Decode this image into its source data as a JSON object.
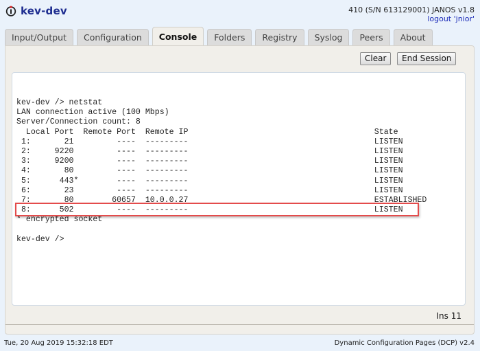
{
  "header": {
    "title": "kev-dev",
    "icon": "info-power-icon",
    "device_info": "410 (S/N 613129001) JANOS v1.8",
    "logout_label": "logout 'jnior'"
  },
  "tabs": [
    {
      "label": "Input/Output",
      "active": false
    },
    {
      "label": "Configuration",
      "active": false
    },
    {
      "label": "Console",
      "active": true
    },
    {
      "label": "Folders",
      "active": false
    },
    {
      "label": "Registry",
      "active": false
    },
    {
      "label": "Syslog",
      "active": false
    },
    {
      "label": "Peers",
      "active": false
    },
    {
      "label": "About",
      "active": false
    }
  ],
  "toolbar": {
    "clear_label": "Clear",
    "end_session_label": "End Session"
  },
  "console": {
    "lines": [
      "kev-dev /> netstat",
      "LAN connection active (100 Mbps)",
      "Server/Connection count: 8",
      "  Local Port  Remote Port  Remote IP                                       State",
      " 1:       21         ----  ---------                                       LISTEN",
      " 2:     9220         ----  ---------                                       LISTEN",
      " 3:     9200         ----  ---------                                       LISTEN",
      " 4:       80         ----  ---------                                       LISTEN",
      " 5:      443*        ----  ---------                                       LISTEN",
      " 6:       23         ----  ---------                                       LISTEN",
      " 7:       80        60657  10.0.0.27                                       ESTABLISHED",
      " 8:      502         ----  ---------                                       LISTEN",
      "* encrypted socket",
      "",
      "kev-dev />"
    ],
    "highlighted_row": 8,
    "highlight_color": "#e44b4b"
  },
  "status": {
    "ins_label": "Ins 11"
  },
  "footer": {
    "timestamp": "Tue, 20 Aug 2019 15:32:18 EDT",
    "version": "Dynamic Configuration Pages (DCP) v2.4"
  }
}
